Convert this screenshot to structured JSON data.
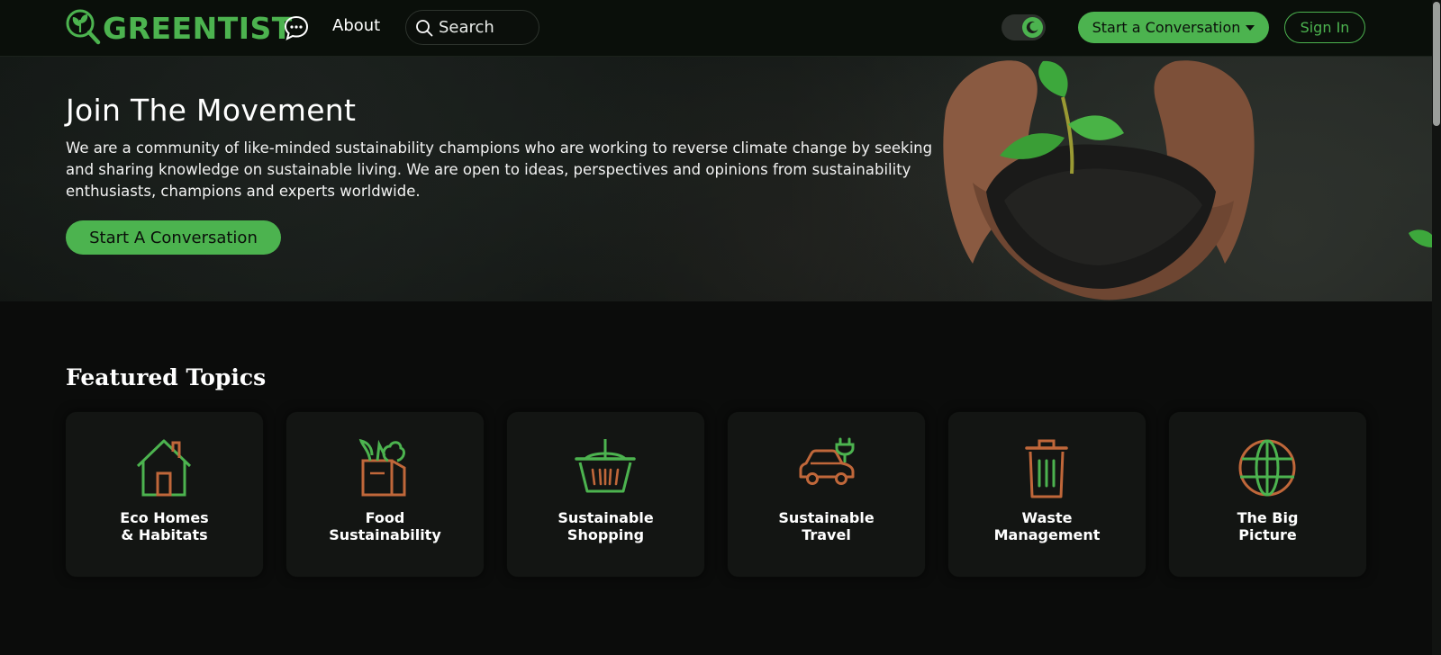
{
  "brand": {
    "name": "GREENTIST",
    "accent": "#4cb34f",
    "accent_alt": "#c0673a"
  },
  "nav": {
    "about": "About",
    "search_placeholder": "Search",
    "start_conversation": "Start a Conversation",
    "sign_in": "Sign In"
  },
  "hero": {
    "title": "Join The Movement",
    "text": "We are a community of like-minded sustainability champions who are working to reverse climate change by seeking and sharing knowledge on sustainable living. We are open to ideas, perspectives and opinions from sustainability enthusiasts, champions and experts worldwide.",
    "cta": "Start A Conversation"
  },
  "featured": {
    "title": "Featured Topics",
    "topics": [
      {
        "label": "Eco Homes\n& Habitats",
        "icon": "house-icon"
      },
      {
        "label": "Food\nSustainability",
        "icon": "grocery-bag-icon"
      },
      {
        "label": "Sustainable\nShopping",
        "icon": "basket-icon"
      },
      {
        "label": "Sustainable\nTravel",
        "icon": "electric-car-icon"
      },
      {
        "label": "Waste\nManagement",
        "icon": "trash-bin-icon"
      },
      {
        "label": "The Big\nPicture",
        "icon": "globe-icon"
      }
    ]
  }
}
